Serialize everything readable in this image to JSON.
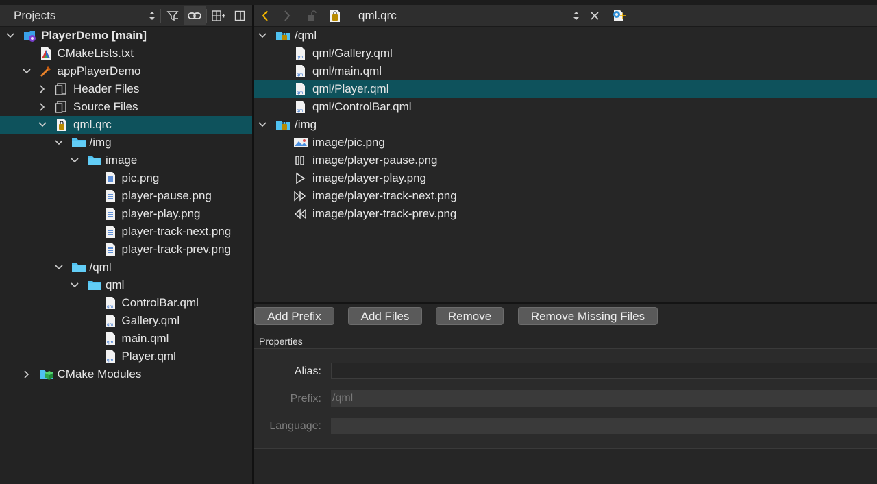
{
  "left_panel": {
    "title": "Projects",
    "tree": [
      {
        "label": "PlayerDemo [main]",
        "bold": true,
        "icon": "project-icon",
        "arrow": "down",
        "indent": 0
      },
      {
        "label": "CMakeLists.txt",
        "icon": "cmake-file-icon",
        "arrow": "",
        "indent": 1
      },
      {
        "label": "appPlayerDemo",
        "icon": "build-target-icon",
        "arrow": "down",
        "indent": 1
      },
      {
        "label": "Header Files",
        "icon": "header-group-icon",
        "arrow": "right",
        "indent": 2
      },
      {
        "label": "Source Files",
        "icon": "source-group-icon",
        "arrow": "right",
        "indent": 2
      },
      {
        "label": "qml.qrc",
        "icon": "qrc-file-icon",
        "arrow": "down",
        "indent": 2,
        "selected": true
      },
      {
        "label": "/img",
        "icon": "folder-icon",
        "arrow": "down",
        "indent": 3
      },
      {
        "label": "image",
        "icon": "folder-icon",
        "arrow": "down",
        "indent": 4
      },
      {
        "label": "pic.png",
        "icon": "image-file-icon",
        "arrow": "",
        "indent": 5
      },
      {
        "label": "player-pause.png",
        "icon": "image-file-icon",
        "arrow": "",
        "indent": 5
      },
      {
        "label": "player-play.png",
        "icon": "image-file-icon",
        "arrow": "",
        "indent": 5
      },
      {
        "label": "player-track-next.png",
        "icon": "image-file-icon",
        "arrow": "",
        "indent": 5
      },
      {
        "label": "player-track-prev.png",
        "icon": "image-file-icon",
        "arrow": "",
        "indent": 5
      },
      {
        "label": "/qml",
        "icon": "folder-icon",
        "arrow": "down",
        "indent": 3
      },
      {
        "label": "qml",
        "icon": "folder-icon",
        "arrow": "down",
        "indent": 4
      },
      {
        "label": "ControlBar.qml",
        "icon": "qml-file-icon",
        "arrow": "",
        "indent": 5
      },
      {
        "label": "Gallery.qml",
        "icon": "qml-file-icon",
        "arrow": "",
        "indent": 5
      },
      {
        "label": "main.qml",
        "icon": "qml-file-icon",
        "arrow": "",
        "indent": 5
      },
      {
        "label": "Player.qml",
        "icon": "qml-file-icon",
        "arrow": "",
        "indent": 5
      },
      {
        "label": "CMake Modules",
        "icon": "cmake-modules-icon",
        "arrow": "right",
        "indent": 1
      }
    ]
  },
  "editor": {
    "title": "qml.qrc",
    "resources": [
      {
        "label": "/qml",
        "icon": "prefix-icon",
        "arrow": "down",
        "indent": 0
      },
      {
        "label": "qml/Gallery.qml",
        "icon": "qml-file-icon",
        "arrow": "",
        "indent": 1
      },
      {
        "label": "qml/main.qml",
        "icon": "qml-file-icon",
        "arrow": "",
        "indent": 1
      },
      {
        "label": "qml/Player.qml",
        "icon": "qml-file-icon",
        "arrow": "",
        "indent": 1,
        "selected": true
      },
      {
        "label": "qml/ControlBar.qml",
        "icon": "qml-file-icon",
        "arrow": "",
        "indent": 1
      },
      {
        "label": "/img",
        "icon": "prefix-icon",
        "arrow": "down",
        "indent": 0
      },
      {
        "label": "image/pic.png",
        "icon": "picture-icon",
        "arrow": "",
        "indent": 1
      },
      {
        "label": "image/player-pause.png",
        "icon": "pause-icon",
        "arrow": "",
        "indent": 1
      },
      {
        "label": "image/player-play.png",
        "icon": "play-icon",
        "arrow": "",
        "indent": 1
      },
      {
        "label": "image/player-track-next.png",
        "icon": "track-next-icon",
        "arrow": "",
        "indent": 1
      },
      {
        "label": "image/player-track-prev.png",
        "icon": "track-prev-icon",
        "arrow": "",
        "indent": 1
      }
    ],
    "buttons": {
      "add_prefix": "Add Prefix",
      "add_files": "Add Files",
      "remove": "Remove",
      "remove_missing": "Remove Missing Files"
    },
    "properties": {
      "heading": "Properties",
      "alias_label": "Alias:",
      "alias_value": "",
      "prefix_label": "Prefix:",
      "prefix_value": "/qml",
      "language_label": "Language:",
      "language_value": ""
    }
  },
  "colors": {
    "selection": "#0e525c",
    "folder": "#4fc1f0",
    "nav_arrow": "#f0b400"
  }
}
